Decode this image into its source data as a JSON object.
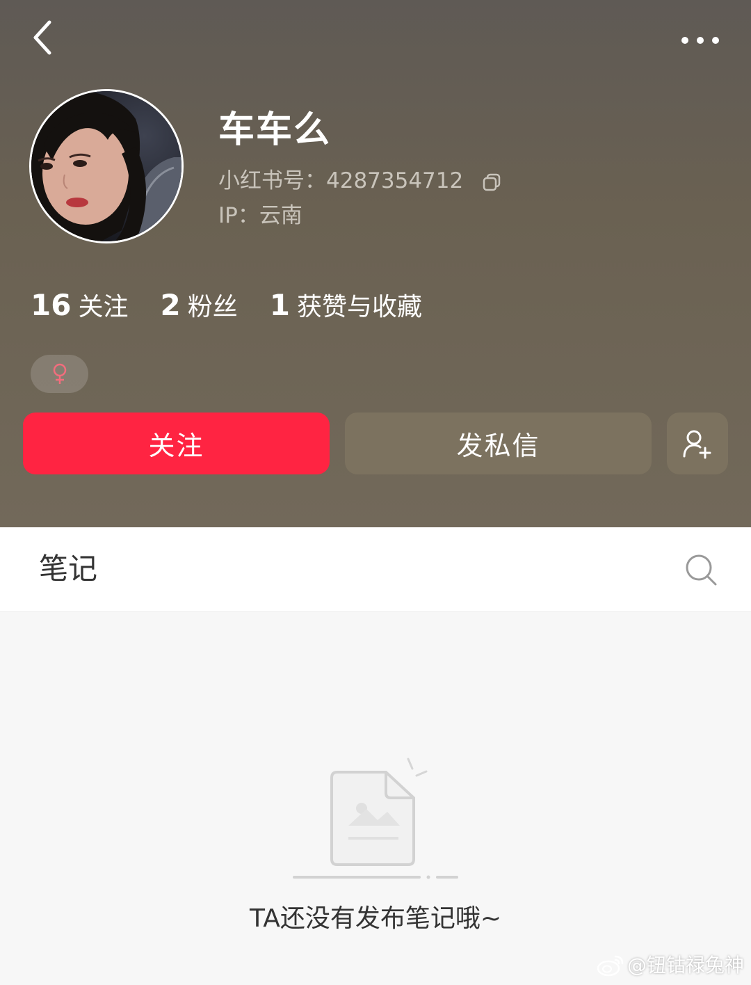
{
  "profile": {
    "nickname": "车车么",
    "xhs_id_label": "小红书号：4287354712",
    "ip_label": "IP：云南",
    "gender": "♀"
  },
  "stats": [
    {
      "value": "16",
      "label": "关注"
    },
    {
      "value": "2",
      "label": "粉丝"
    },
    {
      "value": "1",
      "label": "获赞与收藏"
    }
  ],
  "actions": {
    "follow_label": "关注",
    "message_label": "发私信"
  },
  "tabs": {
    "notes_label": "笔记"
  },
  "empty_state": {
    "message": "TA还没有发布笔记哦~"
  },
  "watermark": {
    "text": "@钮钴禄兔神"
  },
  "icons": {
    "back": "back-arrow-icon",
    "more": "more-dots-icon",
    "copy": "copy-icon",
    "add_friend": "add-friend-icon",
    "search": "search-icon",
    "empty": "empty-document-image-icon",
    "weibo": "weibo-logo-icon"
  },
  "colors": {
    "header_bg": "#6a6152",
    "follow_button": "#ff2442",
    "message_button": "#7c725f",
    "gender_symbol": "#f26d7d"
  }
}
